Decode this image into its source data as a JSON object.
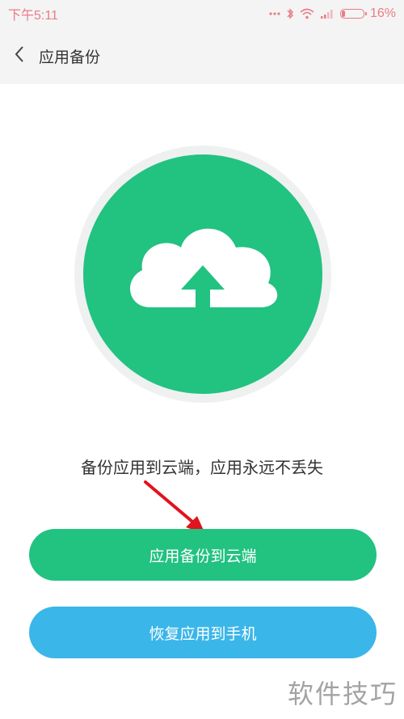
{
  "status_bar": {
    "time": "下午5:11",
    "battery_percent": "16%",
    "battery_level": 0.16,
    "icons": [
      "dots-icon",
      "bluetooth-icon",
      "wifi-icon",
      "signal-icon",
      "battery-icon"
    ]
  },
  "header": {
    "back_icon": "chevron-left-icon",
    "title": "应用备份"
  },
  "hero": {
    "icon": "cloud-upload-icon",
    "color": "#22c281",
    "ring_color": "#eef1f0"
  },
  "tagline": "备份应用到云端，应用永远不丢失",
  "buttons": {
    "backup_label": "应用备份到云端",
    "backup_color": "#22c281",
    "restore_label": "恢复应用到手机",
    "restore_color": "#3bb6e9"
  },
  "annotation": {
    "arrow_color": "#e0141e"
  },
  "watermark": "软件技巧"
}
